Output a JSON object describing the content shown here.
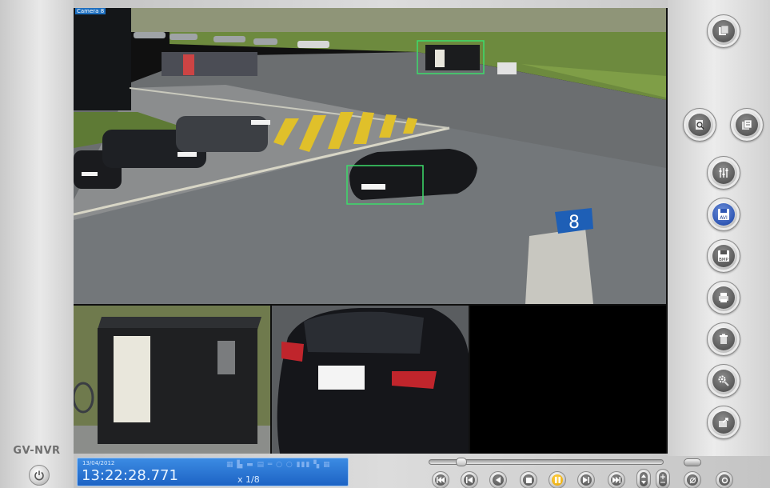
{
  "app": {
    "brand": "GV-NVR"
  },
  "cameras": {
    "main_label": "Camera 8",
    "sign_number": "8"
  },
  "status": {
    "date": "13/04/2012",
    "time": "13:22:28.771",
    "speed": "x 1/8"
  },
  "toolbar": {
    "buttons": [
      {
        "name": "camera-list-button",
        "icon": "camera-list-icon"
      },
      {
        "name": "search-button",
        "icon": "search-icon"
      },
      {
        "name": "playlist-button",
        "icon": "playlist-icon"
      },
      {
        "name": "adjust-button",
        "icon": "sliders-icon"
      },
      {
        "name": "save-avi-button",
        "icon": "save-avi-icon",
        "label": "AVI",
        "active": true
      },
      {
        "name": "save-bmp-button",
        "icon": "save-bmp-icon",
        "label": "BMP"
      },
      {
        "name": "print-button",
        "icon": "print-icon"
      },
      {
        "name": "delete-button",
        "icon": "trash-icon"
      },
      {
        "name": "settings-button",
        "icon": "gear-wrench-icon"
      },
      {
        "name": "export-button",
        "icon": "export-icon"
      }
    ]
  },
  "playback": {
    "progress": 0.12,
    "controls": [
      "go-start",
      "step-back",
      "reverse-play",
      "stop",
      "pause",
      "forward",
      "go-end",
      "speed-down",
      "speed-up"
    ]
  },
  "colors": {
    "status_bg": "#1d63c4",
    "detection_box": "#3ddc6b",
    "accent_play": "#e5a300",
    "accent_active": "#2f57b5"
  }
}
